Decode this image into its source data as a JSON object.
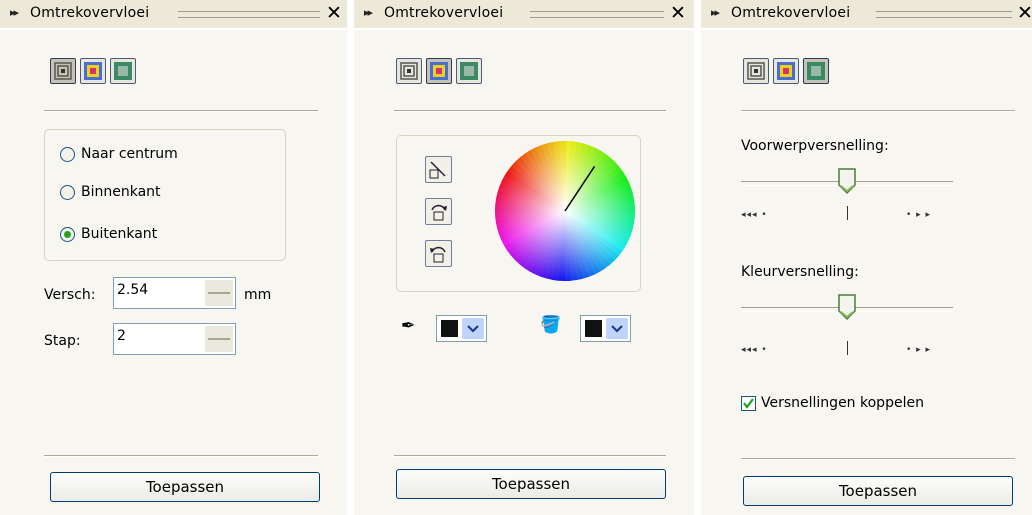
{
  "panel_title": "Omtrekovervloei",
  "close_glyph": "✕",
  "expand_glyph": "▸▸",
  "apply_label": "Toepassen",
  "panel1": {
    "direction_options": [
      {
        "label": "Naar centrum",
        "selected": false
      },
      {
        "label": "Binnenkant",
        "selected": false
      },
      {
        "label": "Buitenkant",
        "selected": true
      }
    ],
    "offset_label": "Versch:",
    "offset_value": "2.54",
    "offset_unit": "mm",
    "steps_label": "Stap:",
    "steps_value": "2"
  },
  "panel2": {
    "color_wheel_angle_deg": 140,
    "outline_color": "#111111",
    "fill_color": "#111111"
  },
  "panel3": {
    "object_accel_label": "Voorwerpversnelling:",
    "object_accel_level": 0.5,
    "color_accel_label": "Kleurversnelling:",
    "color_accel_level": 0.5,
    "tick_left": "◂◂◂ •",
    "tick_right": "• ▸ ▸",
    "link_accel_label": "Versnellingen koppelen",
    "link_accel_checked": true
  },
  "colors": {
    "panel_bg": "#f7f6f0",
    "titlebar_bg": "#ece9d8",
    "radio_dot": "#26a11a",
    "dropdown_arrow_bg": "#c1d3fb"
  }
}
